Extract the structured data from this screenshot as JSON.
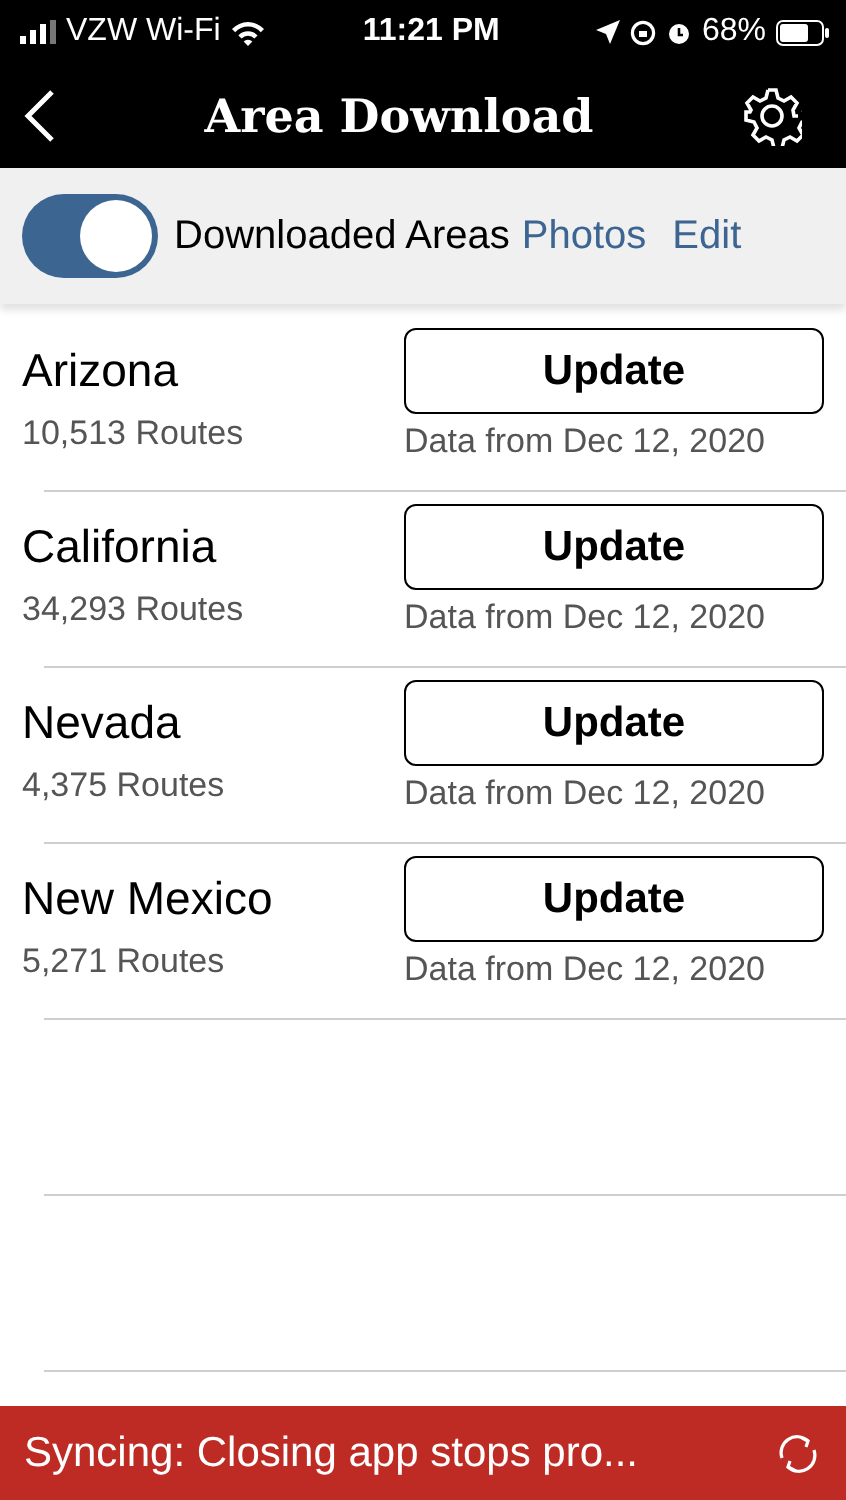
{
  "status_bar": {
    "carrier": "VZW Wi-Fi",
    "time": "11:21 PM",
    "battery": "68%"
  },
  "nav": {
    "title": "Area Download"
  },
  "toolbar": {
    "toggle": {
      "label": "Downloaded Areas",
      "on": true
    },
    "links": [
      "Photos",
      "Edit"
    ]
  },
  "areas": [
    {
      "name": "Arizona",
      "routes": "10,513 Routes",
      "button": "Update",
      "date": "Data from Dec 12, 2020"
    },
    {
      "name": "California",
      "routes": "34,293 Routes",
      "button": "Update",
      "date": "Data from Dec 12, 2020"
    },
    {
      "name": "Nevada",
      "routes": "4,375 Routes",
      "button": "Update",
      "date": "Data from Dec 12, 2020"
    },
    {
      "name": "New Mexico",
      "routes": "5,271 Routes",
      "button": "Update",
      "date": "Data from Dec 12, 2020"
    }
  ],
  "banner": {
    "message": "Syncing: Closing app stops pro..."
  }
}
